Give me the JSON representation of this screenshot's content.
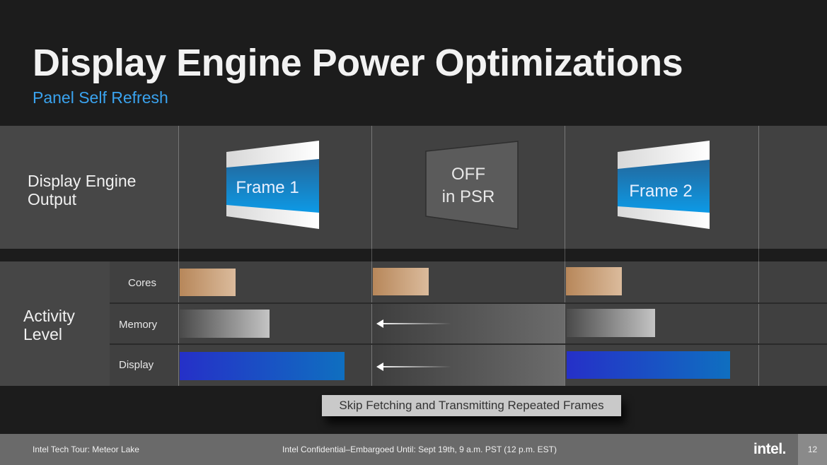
{
  "header": {
    "title": "Display Engine Power Optimizations",
    "subtitle": "Panel Self Refresh"
  },
  "output_row": {
    "label": "Display Engine Output",
    "frames": [
      {
        "text": "Frame 1",
        "state": "on"
      },
      {
        "text": "OFF in PSR",
        "line1": "OFF",
        "line2": "in PSR",
        "state": "off"
      },
      {
        "text": "Frame 2",
        "state": "on"
      }
    ]
  },
  "activity": {
    "label": "Activity Level",
    "rows": [
      {
        "label": "Cores"
      },
      {
        "label": "Memory"
      },
      {
        "label": "Display"
      }
    ]
  },
  "callout": "Skip Fetching and Transmitting Repeated Frames",
  "footer": {
    "left": "Intel Tech Tour:  Meteor Lake",
    "center": "Intel Confidential–Embargoed Until: Sept 19th, 9 a.m. PST (12 p.m. EST)",
    "logo": "intel.",
    "page": "12"
  },
  "colors": {
    "accent": "#3aa3ef",
    "cores": "#c9a07a",
    "display": "#1f4fc4",
    "frame_blue": "#1a78c2"
  }
}
